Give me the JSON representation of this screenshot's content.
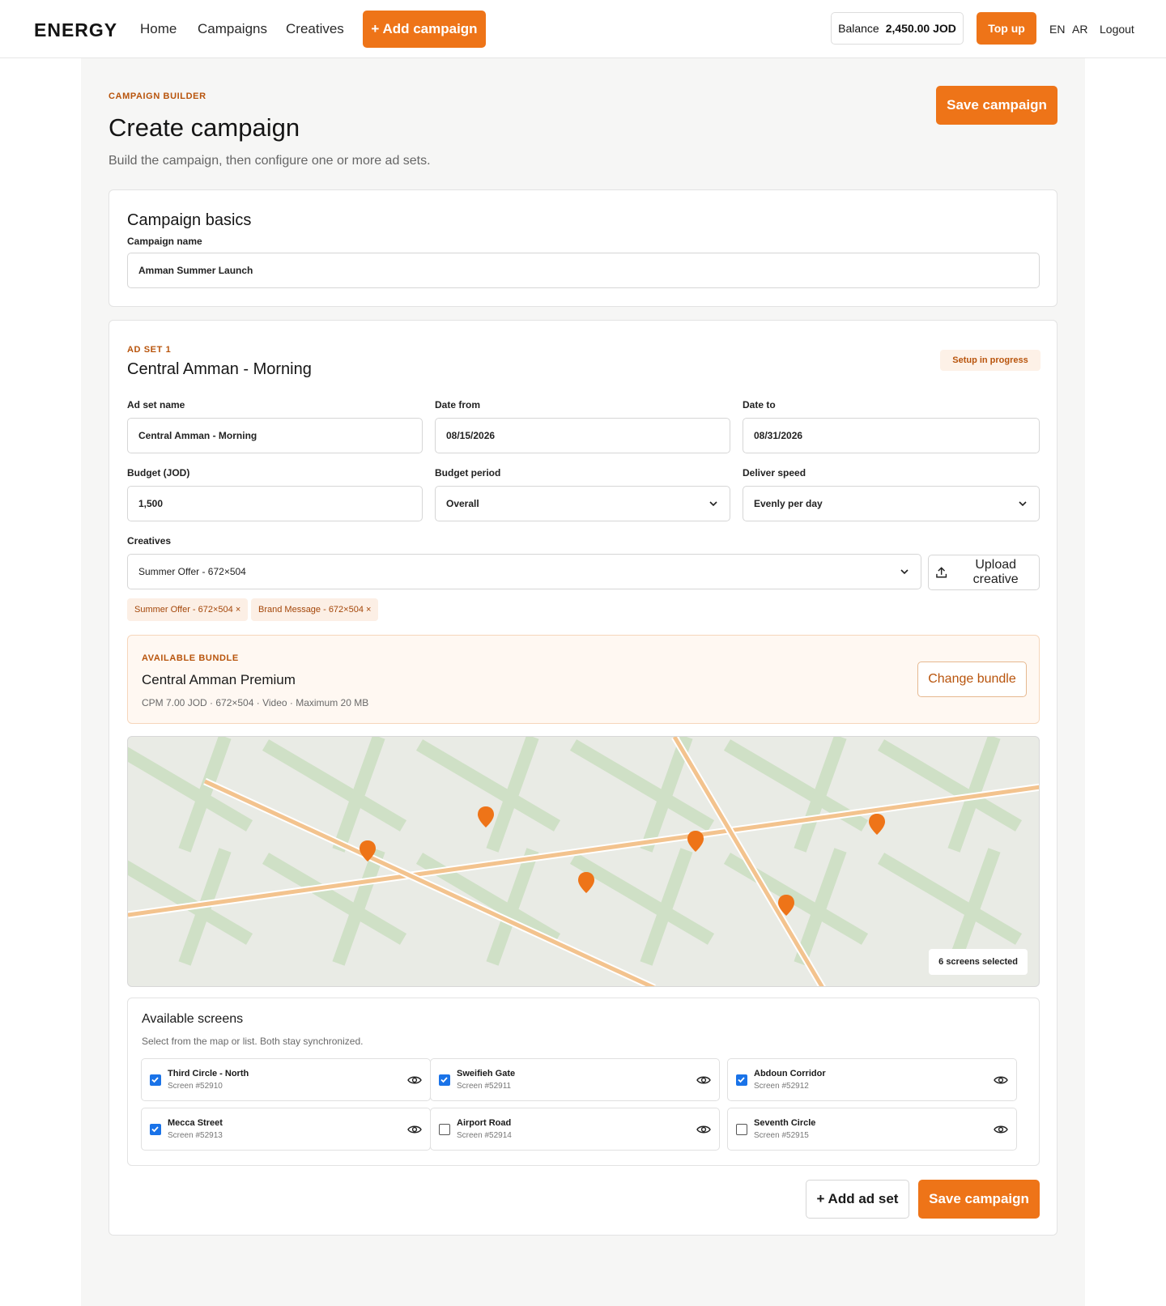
{
  "nav": {
    "brand": "ENERGY",
    "links": [
      "Home",
      "Campaigns",
      "Creatives"
    ],
    "add_campaign": "+ Add campaign",
    "balance_label": "Balance",
    "balance_amount": "2,450.00 JOD",
    "topup": "Top up",
    "lang_en": "EN",
    "lang_ar": "AR",
    "logout": "Logout"
  },
  "header": {
    "eyebrow": "CAMPAIGN BUILDER",
    "title": "Create campaign",
    "subtitle": "Build the campaign, then configure one or more ad sets.",
    "save": "Save campaign"
  },
  "basics": {
    "title": "Campaign basics",
    "name_label": "Campaign name",
    "name_value": "Amman Summer Launch"
  },
  "adset": {
    "eyebrow": "AD SET 1",
    "title": "Central Amman - Morning",
    "status": "Setup in progress",
    "name_label": "Ad set name",
    "name_value": "Central Amman - Morning",
    "date_from_label": "Date from",
    "date_from": "08/15/2026",
    "date_to_label": "Date to",
    "date_to": "08/31/2026",
    "budget_label": "Budget (JOD)",
    "budget": "1,500",
    "period_label": "Budget period",
    "period": "Overall",
    "speed_label": "Deliver speed",
    "speed": "Evenly per day",
    "creatives_label": "Creatives",
    "creative_selected": "Summer Offer - 672×504",
    "upload": "Upload creative",
    "chips": [
      "Summer Offer - 672×504 ×",
      "Brand Message - 672×504 ×"
    ],
    "bundle": {
      "eyebrow": "AVAILABLE BUNDLE",
      "name": "Central Amman Premium",
      "meta": "CPM 7.00 JOD · 672×504 · Video · Maximum 20 MB",
      "change": "Change bundle"
    },
    "map_badge": "6 screens selected",
    "screens_title": "Available screens",
    "screens_sub": "Select from the map or list. Both stay synchronized.",
    "screens": [
      {
        "name": "Third Circle - North",
        "id": "Screen #52910",
        "checked": true
      },
      {
        "name": "Sweifieh Gate",
        "id": "Screen #52911",
        "checked": true
      },
      {
        "name": "Abdoun Corridor",
        "id": "Screen #52912",
        "checked": true
      },
      {
        "name": "Mecca Street",
        "id": "Screen #52913",
        "checked": true
      },
      {
        "name": "Airport Road",
        "id": "Screen #52914",
        "checked": false
      },
      {
        "name": "Seventh Circle",
        "id": "Screen #52915",
        "checked": false
      }
    ],
    "add_adset": "+ Add ad set",
    "save": "Save campaign"
  },
  "colors": {
    "accent": "#ee7418",
    "accent_text": "#b8540c",
    "page_bg": "#f6f6f5",
    "map_road": "#f3c38e",
    "map_park": "#cfe0c6"
  },
  "icons": [
    "chevron-down-icon",
    "upload-icon",
    "map-pin-icon",
    "eye-icon",
    "checkbox-icon"
  ]
}
